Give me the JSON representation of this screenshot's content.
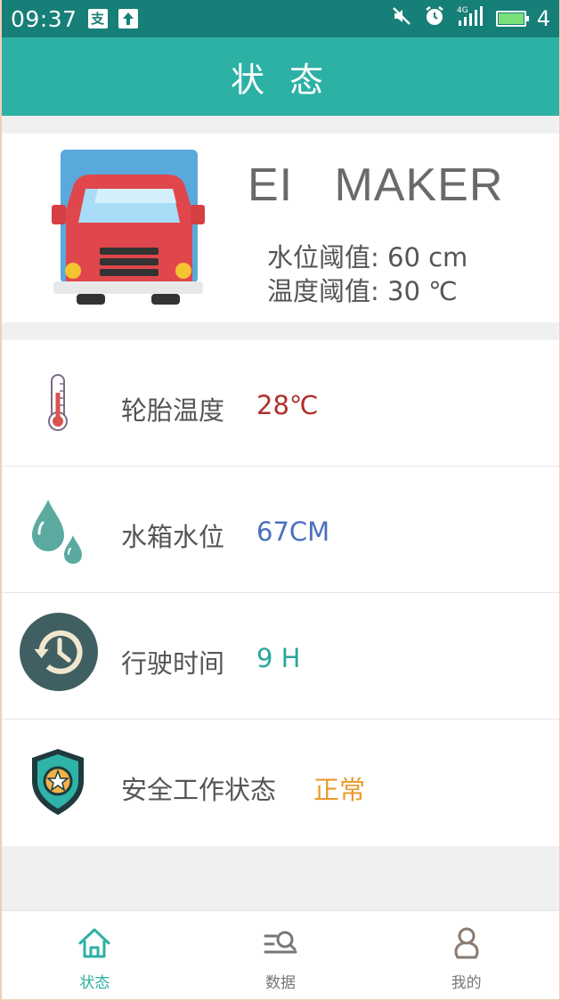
{
  "status_bar": {
    "time": "09:37",
    "notify_glyph": "支",
    "battery_level": "4"
  },
  "header": {
    "title": "状 态"
  },
  "profile": {
    "name": "EI   MAKER",
    "water_threshold": "水位阈值: 60 cm",
    "temp_threshold": "温度阈值: 30 ℃"
  },
  "rows": [
    {
      "label": "轮胎温度",
      "value": "28℃",
      "color": "#b0302c",
      "icon": "thermometer-icon"
    },
    {
      "label": "水箱水位",
      "value": "67CM",
      "color": "#4a6fc0",
      "icon": "water-drop-icon"
    },
    {
      "label": "行驶时间",
      "value": "9 H",
      "color": "#2aa79b",
      "icon": "history-clock-icon"
    },
    {
      "label": "安全工作状态",
      "value": "正常",
      "color": "#e89a2c",
      "icon": "shield-star-icon"
    }
  ],
  "nav": [
    {
      "label": "状态",
      "icon": "home-icon",
      "active": true
    },
    {
      "label": "数据",
      "icon": "data-search-icon",
      "active": false
    },
    {
      "label": "我的",
      "icon": "user-icon",
      "active": false
    }
  ],
  "colors": {
    "accent": "#2db1a5",
    "statusbar": "#167f77"
  }
}
